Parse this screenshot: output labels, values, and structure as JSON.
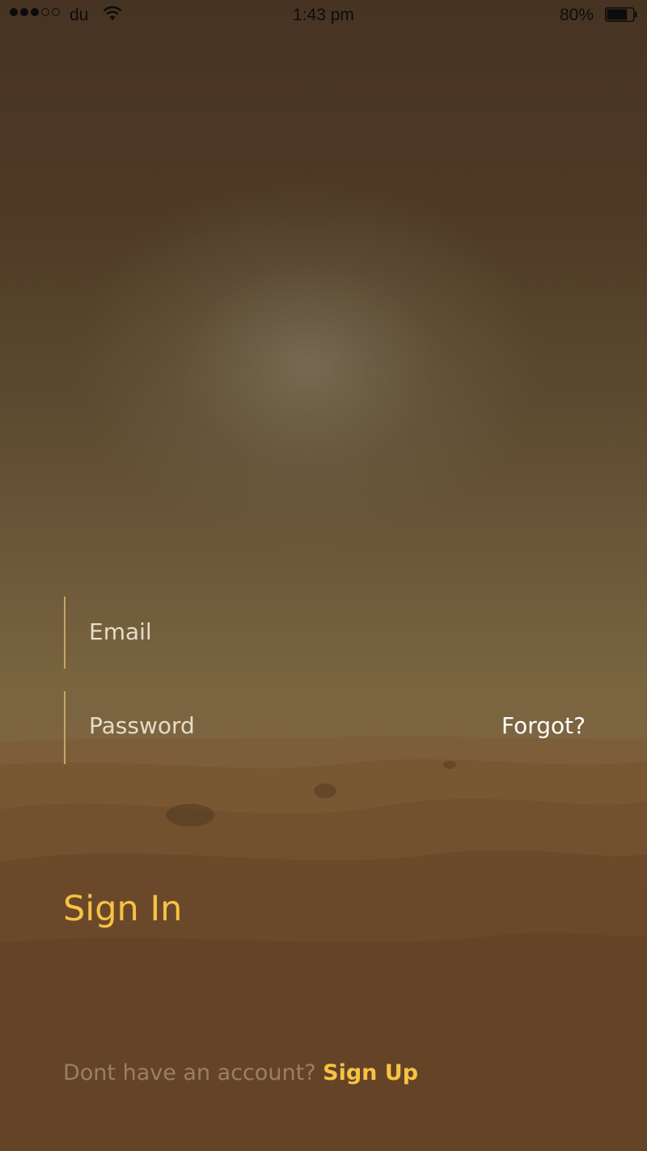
{
  "status_bar": {
    "carrier": "du",
    "time": "1:43 pm",
    "battery_percent": "80%",
    "battery_level": 0.8,
    "signal_bars_filled": 3,
    "signal_bars_total": 5,
    "icons": [
      "signal-dots-icon",
      "wifi-icon",
      "battery-icon"
    ]
  },
  "form": {
    "email_placeholder": "Email",
    "password_placeholder": "Password",
    "forgot_label": "Forgot?",
    "signin_label": "Sign In"
  },
  "footer": {
    "prompt": "Dont have an account?",
    "signup_label": "Sign Up"
  },
  "colors": {
    "accent": "#f6c343",
    "field_border": "#c7a46a",
    "placeholder": "#e6ddc8",
    "muted_text": "#9a8062"
  }
}
